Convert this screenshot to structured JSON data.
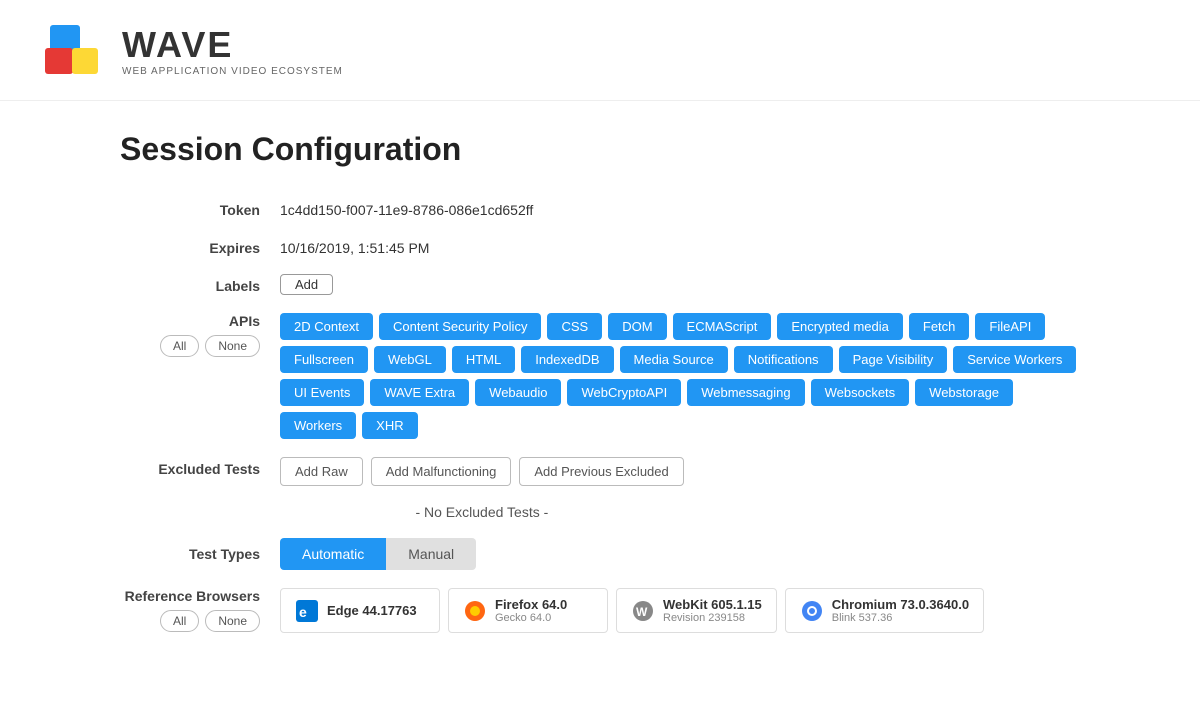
{
  "header": {
    "logo_wave": "WAVE",
    "logo_subtitle": "WEB APPLICATION VIDEO ECOSYSTEM"
  },
  "page": {
    "title": "Session Configuration"
  },
  "form": {
    "token_label": "Token",
    "token_value": "1c4dd150-f007-11e9-8786-086e1cd652ff",
    "expires_label": "Expires",
    "expires_value": "10/16/2019, 1:51:45 PM",
    "labels_label": "Labels",
    "labels_add": "Add",
    "apis_label": "APIs",
    "all_label": "All",
    "none_label": "None",
    "excluded_label": "Excluded Tests",
    "add_raw": "Add Raw",
    "add_malfunctioning": "Add Malfunctioning",
    "add_previous_excluded": "Add Previous Excluded",
    "no_excluded": "- No Excluded Tests -",
    "test_types_label": "Test Types",
    "automatic_label": "Automatic",
    "manual_label": "Manual",
    "ref_browsers_label": "Reference Browsers",
    "ref_all": "All",
    "ref_none": "None"
  },
  "apis": [
    "2D Context",
    "Content Security Policy",
    "CSS",
    "DOM",
    "ECMAScript",
    "Encrypted media",
    "Fetch",
    "FileAPI",
    "Fullscreen",
    "WebGL",
    "HTML",
    "IndexedDB",
    "Media Source",
    "Notifications",
    "Page Visibility",
    "Service Workers",
    "UI Events",
    "WAVE Extra",
    "Webaudio",
    "WebCryptoAPI",
    "Webmessaging",
    "Websockets",
    "Webstorage",
    "Workers",
    "XHR"
  ],
  "browsers": [
    {
      "name": "Edge 44.17763",
      "sub": "",
      "icon": "edge"
    },
    {
      "name": "Firefox 64.0",
      "sub": "Gecko 64.0",
      "icon": "firefox"
    },
    {
      "name": "WebKit 605.1.15",
      "sub": "Revision 239158",
      "icon": "webkit"
    },
    {
      "name": "Chromium 73.0.3640.0",
      "sub": "Blink 537.36",
      "icon": "chromium"
    }
  ],
  "colors": {
    "tag_bg": "#2196F3",
    "tag_active": "#1976D2",
    "btn_active_bg": "#2196F3",
    "btn_inactive_bg": "#e0e0e0"
  }
}
